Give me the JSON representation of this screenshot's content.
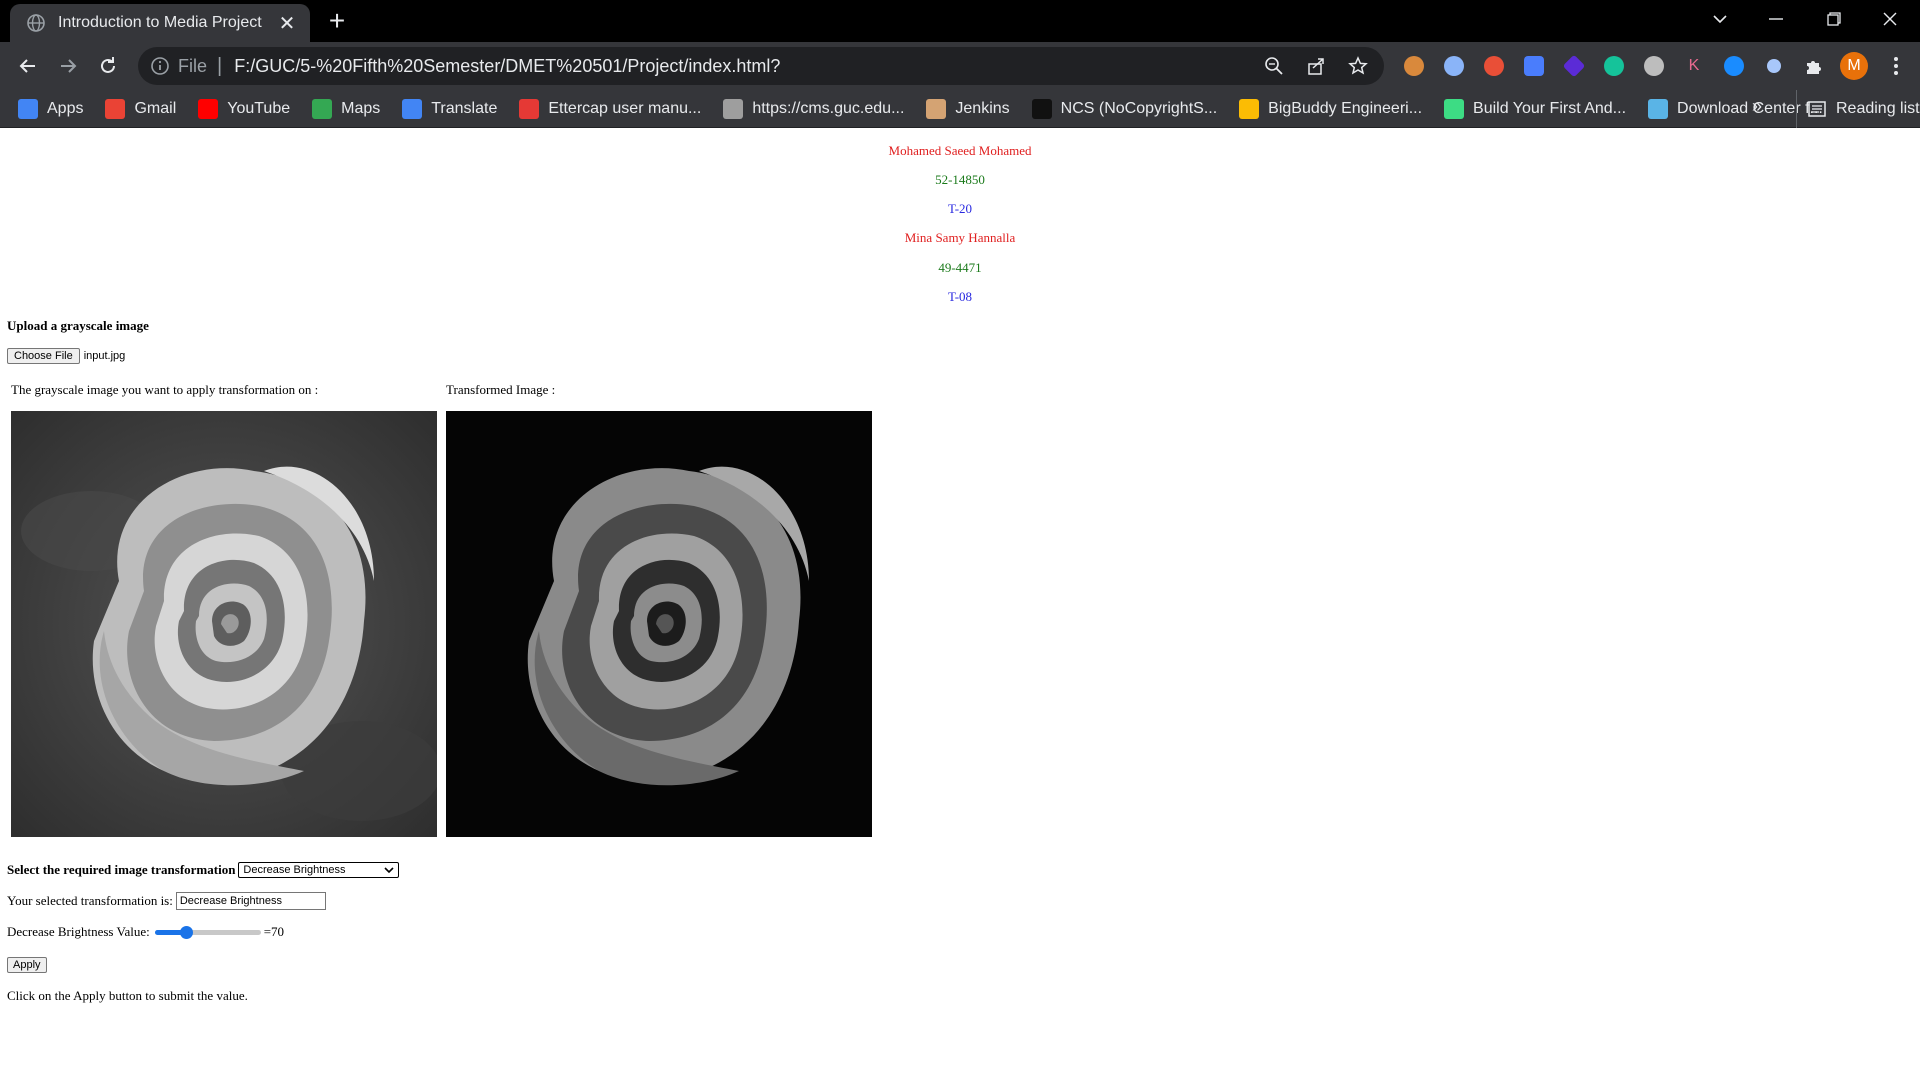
{
  "browser": {
    "tab_title": "Introduction to Media Project",
    "url_scheme": "File",
    "url": "F:/GUC/5-%20Fifth%20Semester/DMET%20501/Project/index.html?",
    "avatar_letter": "M",
    "bookmarks": [
      {
        "label": "Apps",
        "icon": "apps-grid-icon",
        "color": "#4285f4"
      },
      {
        "label": "Gmail",
        "icon": "gmail-icon",
        "color": "#ea4335"
      },
      {
        "label": "YouTube",
        "icon": "youtube-icon",
        "color": "#ff0000"
      },
      {
        "label": "Maps",
        "icon": "maps-pin-icon",
        "color": "#34a853"
      },
      {
        "label": "Translate",
        "icon": "translate-icon",
        "color": "#4285f4"
      },
      {
        "label": "Ettercap user manu...",
        "icon": "checkmark-icon",
        "color": "#e53935"
      },
      {
        "label": "https://cms.guc.edu...",
        "icon": "document-icon",
        "color": "#9e9e9e"
      },
      {
        "label": "Jenkins",
        "icon": "jenkins-icon",
        "color": "#d4a373"
      },
      {
        "label": "NCS (NoCopyrightS...",
        "icon": "ncs-icon",
        "color": "#111111"
      },
      {
        "label": "BigBuddy Engineeri...",
        "icon": "drive-icon",
        "color": "#fbbc04"
      },
      {
        "label": "Build Your First And...",
        "icon": "android-icon",
        "color": "#3ddc84"
      },
      {
        "label": "Download Center f...",
        "icon": "globe-icon",
        "color": "#5ab4e6"
      }
    ],
    "more_bookmarks": "»",
    "reading_list": "Reading list"
  },
  "students": [
    {
      "name": "Mohamed Saeed Mohamed",
      "id": "52-14850",
      "tutorial": "T-20"
    },
    {
      "name": "Mina Samy Hannalla",
      "id": "49-4471",
      "tutorial": "T-08"
    }
  ],
  "upload": {
    "title": "Upload a grayscale image",
    "button_label": "Choose File",
    "file_name": "input.jpg"
  },
  "captions": {
    "original": "The grayscale image you want to apply transformation on :",
    "transformed": "Transformed Image :"
  },
  "transform": {
    "select_label": "Select the required image transformation",
    "selected_option": "Decrease Brightness",
    "selected_text_label": "Your selected transformation is:",
    "selected_text_value": "Decrease Brightness",
    "slider_label": "Decrease Brightness Value:",
    "slider_value": 70,
    "slider_min": 0,
    "slider_max": 255,
    "slider_readout": "=70",
    "apply_label": "Apply",
    "hint": "Click on the Apply button to submit the value."
  },
  "colors": {
    "name": "#e02020",
    "id": "#1b7a1b",
    "tutorial": "#2a2ae0",
    "accent": "#1a73e8"
  }
}
